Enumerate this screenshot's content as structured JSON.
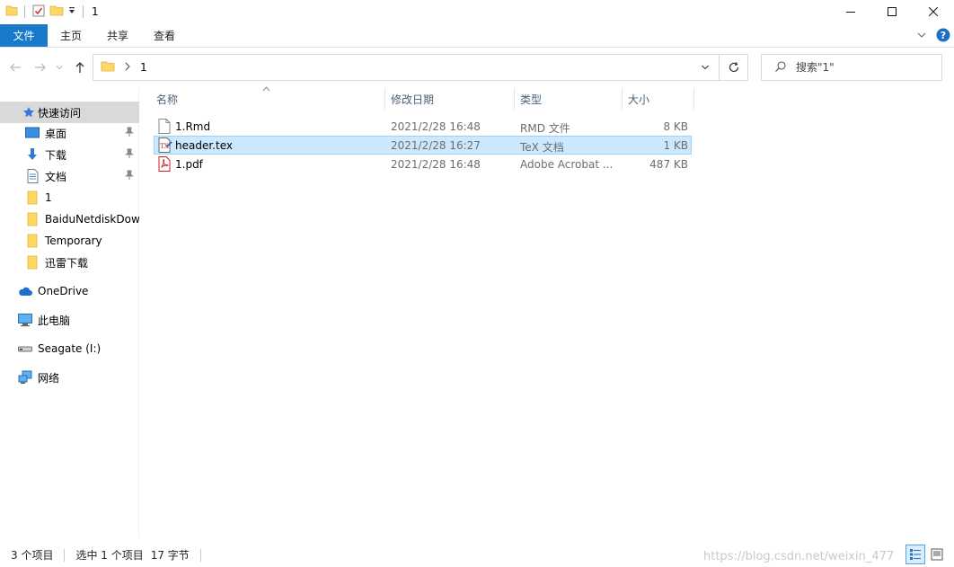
{
  "window": {
    "title": "1"
  },
  "ribbon": {
    "tabs": [
      "文件",
      "主页",
      "共享",
      "查看"
    ]
  },
  "address": {
    "path": [
      "1"
    ]
  },
  "search": {
    "placeholder": "搜索\"1\""
  },
  "sidebar": {
    "quick_access": "快速访问",
    "pinned": [
      "桌面",
      "下载",
      "文档"
    ],
    "folders": [
      "1",
      "BaiduNetdiskDow",
      "Temporary",
      "迅雷下载"
    ],
    "onedrive": "OneDrive",
    "this_pc": "此电脑",
    "drive": "Seagate (I:)",
    "network": "网络"
  },
  "columns": {
    "name": "名称",
    "modified": "修改日期",
    "type": "类型",
    "size": "大小"
  },
  "files": [
    {
      "name": "1.Rmd",
      "modified": "2021/2/28 16:48",
      "type": "RMD 文件",
      "size": "8 KB",
      "icon": "document-icon",
      "selected": false
    },
    {
      "name": "header.tex",
      "modified": "2021/2/28 16:27",
      "type": "TeX 文档",
      "size": "1 KB",
      "icon": "tex-file-icon",
      "selected": true
    },
    {
      "name": "1.pdf",
      "modified": "2021/2/28 16:48",
      "type": "Adobe Acrobat ...",
      "size": "487 KB",
      "icon": "pdf-icon",
      "selected": false
    }
  ],
  "status": {
    "count": "3 个项目",
    "selected": "选中 1 个项目",
    "bytes": "17 字节"
  },
  "watermark": "https://blog.csdn.net/weixin_477",
  "colors": {
    "accent": "#1979ca",
    "selection": "#cce8ff",
    "folder": "#ffd766"
  }
}
